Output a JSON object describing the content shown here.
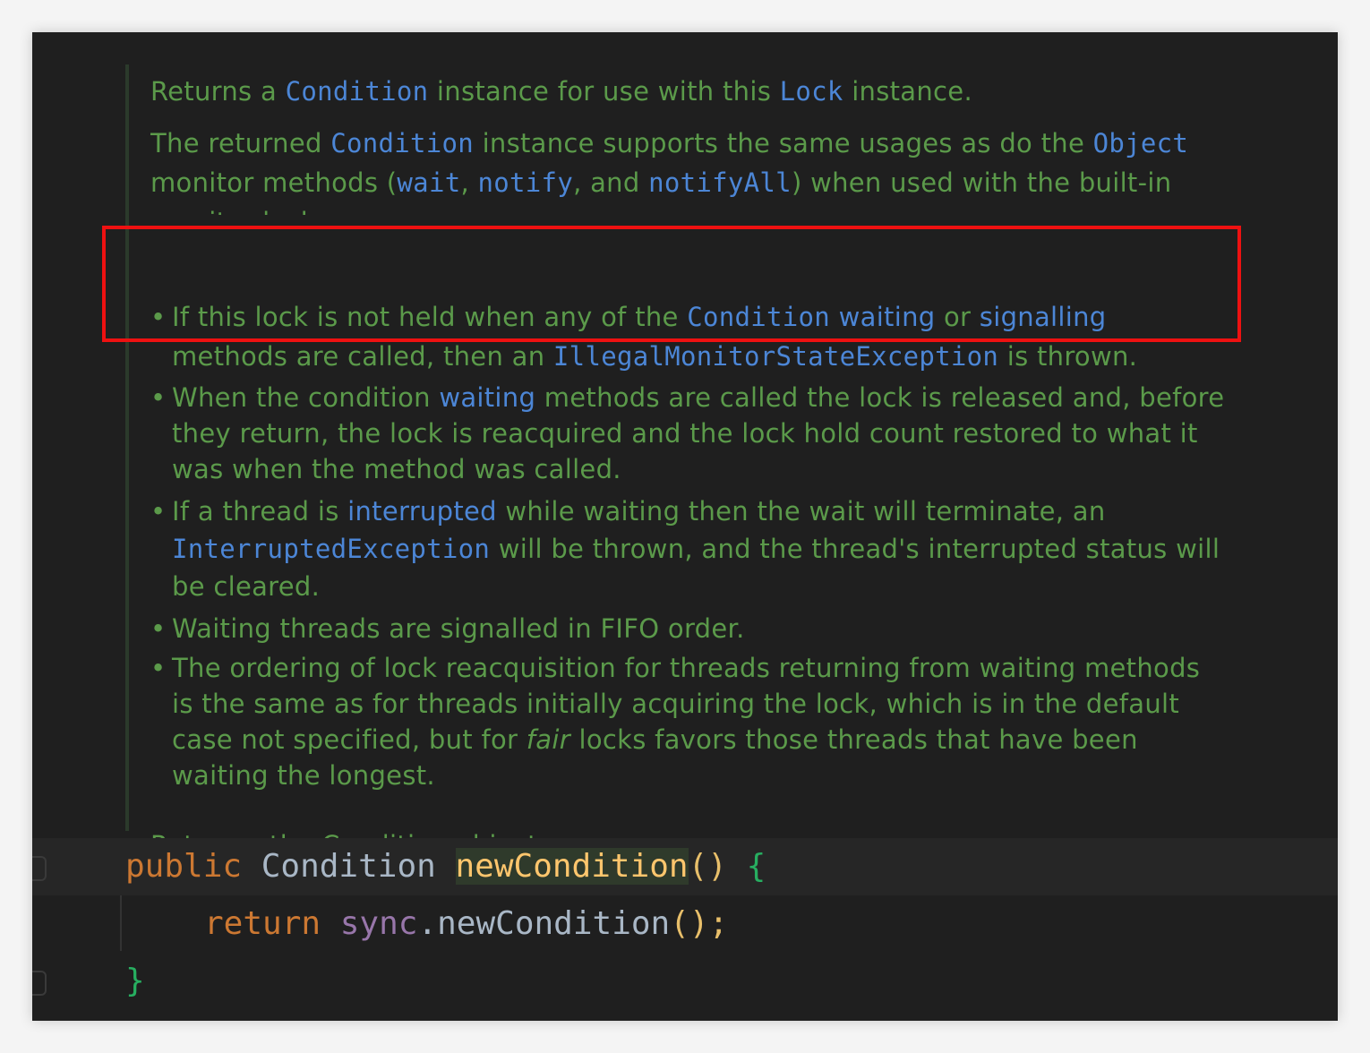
{
  "doc": {
    "p1": {
      "t1": "Returns a ",
      "c1": "Condition",
      "t2": " instance for use with this ",
      "c2": "Lock",
      "t3": " instance."
    },
    "p2": {
      "t1": "The returned ",
      "c1": "Condition",
      "t2": " instance supports the same usages as do the ",
      "c2": "Object",
      "t3": " monitor methods (",
      "c3": "wait",
      "t4": ", ",
      "c4": "notify",
      "t5": ", and ",
      "c5": "notifyAll",
      "t6": ") when used with the built-in monitor lock."
    },
    "bullets": [
      {
        "t1": "If this lock is not held when any of the ",
        "c1": "Condition",
        "s1": " ",
        "l1": "waiting",
        "t2": " or ",
        "l2": "signalling",
        "t3": " methods are called, then an ",
        "c2": "IllegalMonitorStateException",
        "t4": " is thrown."
      },
      {
        "t1": "When the condition ",
        "l1": "waiting",
        "t2": " methods are called the lock is released and, before they return, the lock is reacquired and the lock hold count restored to what it was when the method was called."
      },
      {
        "t1": "If a thread is ",
        "l1": "interrupted",
        "t2": " while waiting then the wait will terminate, an ",
        "c1": "InterruptedException",
        "t3": " will be thrown, and the thread's interrupted status will be cleared."
      },
      {
        "t1": "Waiting threads are signalled in FIFO order."
      },
      {
        "t1": "The ordering of lock reacquisition for threads returning from waiting methods is the same as for threads initially acquiring the lock, which is in the default case not specified, but for ",
        "em": "fair",
        "t2": " locks favors those threads that have been waiting the longest."
      }
    ],
    "bullet_char": "•",
    "returns": "Returns: the Condition object"
  },
  "code": {
    "line1": {
      "kw": "public",
      "sp1": " ",
      "type": "Condition",
      "sp2": " ",
      "fn": "newCondition",
      "paren": "()",
      "sp3": " ",
      "brace": "{"
    },
    "line2": {
      "kw": "return",
      "sp1": " ",
      "field": "sync",
      "dot": ".",
      "call": "newCondition",
      "paren": "()",
      "semi": ";"
    },
    "line3": {
      "brace": "}"
    }
  },
  "colors": {
    "background": "#1f1f1f",
    "doc_text": "#5b9a4a",
    "doc_link": "#4c86d6",
    "keyword": "#cc7832",
    "function": "#ffc66d",
    "field": "#9876aa",
    "brace": "#27ae60",
    "highlight_box": "#ee1111"
  }
}
